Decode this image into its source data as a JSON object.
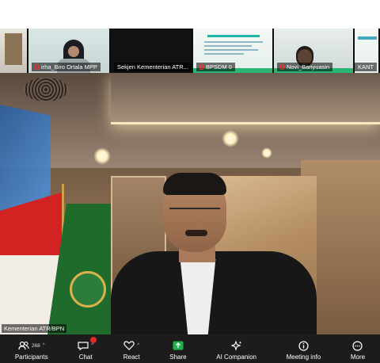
{
  "participants_strip": [
    {
      "name": ""
    },
    {
      "name": "irha_Biro Ortala MPP"
    },
    {
      "name": "Sekjen Kementerian ATR..."
    },
    {
      "name": "BPSDM 0"
    },
    {
      "name": "Novi_Banyuasin"
    },
    {
      "name": "KANT"
    }
  ],
  "main_video": {
    "label": "Kementerian ATR/BPN"
  },
  "toolbar": {
    "participants": {
      "label": "Participants",
      "count": "268"
    },
    "chat": {
      "label": "Chat"
    },
    "react": {
      "label": "React"
    },
    "share": {
      "label": "Share"
    },
    "ai_companion": {
      "label": "AI Companion"
    },
    "meeting_info": {
      "label": "Meeting info"
    },
    "more": {
      "label": "More"
    }
  },
  "colors": {
    "accent_green": "#2bb673",
    "share_green": "#1fb14a",
    "alert_red": "#e02828",
    "toolbar_bg": "#1c1c1c"
  }
}
